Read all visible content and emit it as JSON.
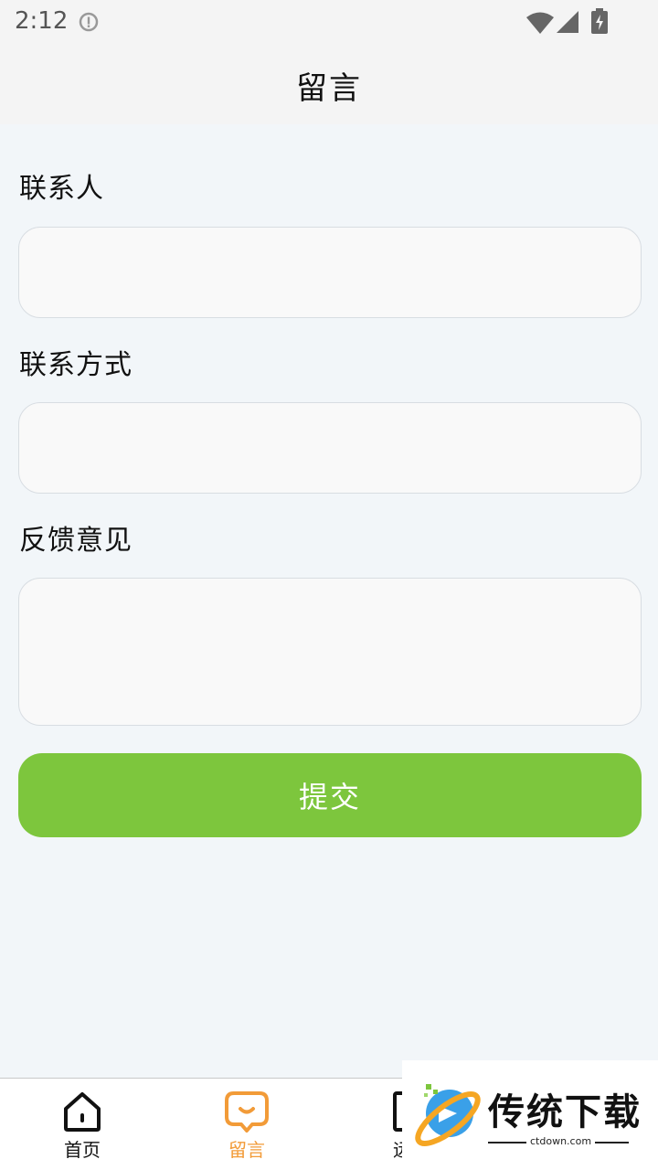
{
  "status_bar": {
    "time": "2:12",
    "icons": [
      "info-icon",
      "wifi-icon",
      "signal-icon",
      "battery-charging-icon"
    ]
  },
  "header": {
    "title": "留言"
  },
  "form": {
    "contact_person_label": "联系人",
    "contact_person_value": "",
    "contact_method_label": "联系方式",
    "contact_method_value": "",
    "feedback_label": "反馈意见",
    "feedback_value": "",
    "submit_label": "提交"
  },
  "bottom_nav": {
    "items": [
      {
        "label": "首页",
        "icon": "home-icon",
        "active": false
      },
      {
        "label": "留言",
        "icon": "message-icon",
        "active": true
      },
      {
        "label": "远程",
        "icon": "remote-icon",
        "active": false
      }
    ]
  },
  "colors": {
    "accent_green": "#7dc63d",
    "active_orange": "#f29b38",
    "background": "#f2f6f9"
  },
  "watermark": {
    "text": "传统下载",
    "url": "ctdown.com"
  }
}
